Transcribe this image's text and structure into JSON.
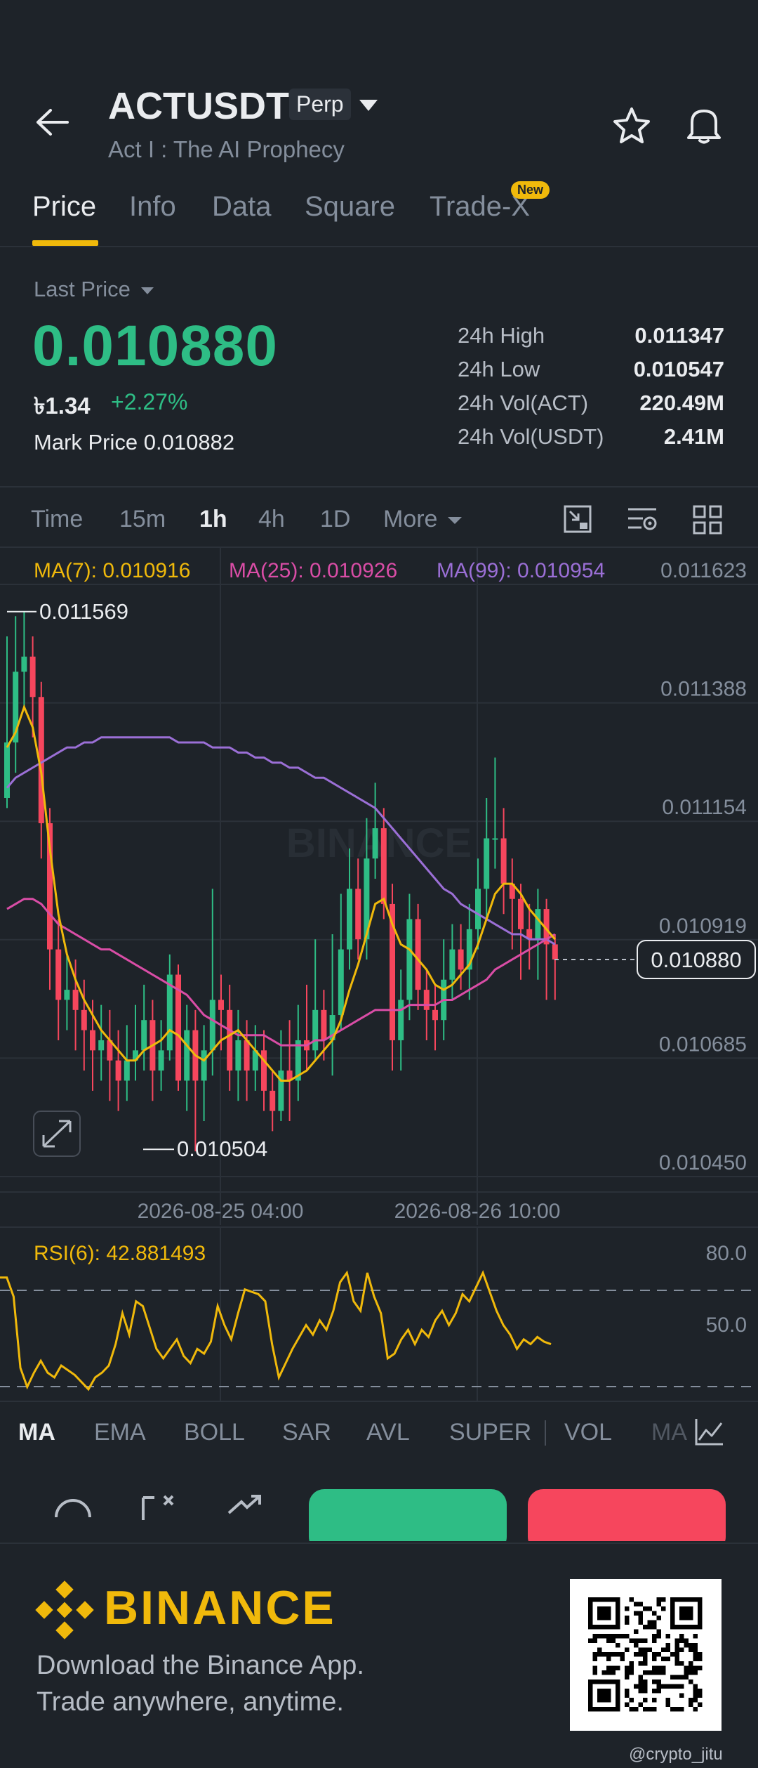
{
  "header": {
    "symbol": "ACTUSDT",
    "contract_badge": "Perp",
    "subtitle": "Act I : The AI Prophecy"
  },
  "tabs": [
    {
      "label": "Price",
      "active": true
    },
    {
      "label": "Info"
    },
    {
      "label": "Data"
    },
    {
      "label": "Square"
    },
    {
      "label": "Trade-X",
      "badge": "New"
    }
  ],
  "price": {
    "selector_label": "Last Price",
    "last_price": "0.010880",
    "fiat_value": "৳1.34",
    "change_pct": "+2.27%",
    "mark_label": "Mark Price",
    "mark_value": "0.010882",
    "stats": [
      {
        "label": "24h High",
        "value": "0.011347"
      },
      {
        "label": "24h Low",
        "value": "0.010547"
      },
      {
        "label": "24h Vol(ACT)",
        "value": "220.49M"
      },
      {
        "label": "24h Vol(USDT)",
        "value": "2.41M"
      }
    ]
  },
  "intervals": [
    {
      "label": "Time"
    },
    {
      "label": "15m"
    },
    {
      "label": "1h",
      "active": true
    },
    {
      "label": "4h"
    },
    {
      "label": "1D"
    },
    {
      "label": "More"
    }
  ],
  "ma_legend": {
    "ma7": "MA(7): 0.010916",
    "ma25": "MA(25): 0.010926",
    "ma99": "MA(99): 0.010954"
  },
  "watermark": "BINANCE",
  "chart_data": [
    {
      "type": "candlestick",
      "y_ticks": [
        "0.011623",
        "0.011388",
        "0.011154",
        "0.010919",
        "0.010685",
        "0.010450"
      ],
      "ylim": [
        0.01045,
        0.011623
      ],
      "x_ticks": [
        "2026-08-25 04:00",
        "2026-08-26 10:00"
      ],
      "high_marker": "0.011569",
      "low_marker": "0.010504",
      "current_price_label": "0.010880",
      "colors": {
        "up": "#2ebd85",
        "down": "#f6465d",
        "ma7": "#f0b90b",
        "ma25": "#d94da6",
        "ma99": "#9b6fd6"
      },
      "candles": [
        [
          0.0112,
          0.01131,
          0.01118,
          0.01152
        ],
        [
          0.01131,
          0.01145,
          0.01125,
          0.01156
        ],
        [
          0.01145,
          0.01148,
          0.01138,
          0.01157
        ],
        [
          0.01148,
          0.0114,
          0.01132,
          0.01152
        ],
        [
          0.0114,
          0.01115,
          0.01108,
          0.01143
        ],
        [
          0.01115,
          0.0109,
          0.01082,
          0.01118
        ],
        [
          0.0109,
          0.0108,
          0.01072,
          0.01096
        ],
        [
          0.0108,
          0.01082,
          0.01074,
          0.01089
        ],
        [
          0.01082,
          0.01078,
          0.0107,
          0.01088
        ],
        [
          0.01078,
          0.01074,
          0.01066,
          0.01084
        ],
        [
          0.01074,
          0.0107,
          0.01062,
          0.0108
        ],
        [
          0.0107,
          0.01072,
          0.01064,
          0.01079
        ],
        [
          0.01072,
          0.01068,
          0.0106,
          0.01078
        ],
        [
          0.01068,
          0.01064,
          0.01058,
          0.01074
        ],
        [
          0.01064,
          0.01068,
          0.0106,
          0.01075
        ],
        [
          0.01068,
          0.0107,
          0.01064,
          0.01079
        ],
        [
          0.0107,
          0.01076,
          0.01066,
          0.01083
        ],
        [
          0.01076,
          0.01066,
          0.0106,
          0.0108
        ],
        [
          0.01066,
          0.0107,
          0.01062,
          0.01076
        ],
        [
          0.0107,
          0.01085,
          0.01068,
          0.01089
        ],
        [
          0.01085,
          0.01064,
          0.01062,
          0.01087
        ],
        [
          0.01064,
          0.01074,
          0.01058,
          0.01079
        ],
        [
          0.01074,
          0.01064,
          0.0105,
          0.01078
        ],
        [
          0.01064,
          0.0107,
          0.01056,
          0.01075
        ],
        [
          0.0107,
          0.0108,
          0.01065,
          0.01102
        ],
        [
          0.0108,
          0.01078,
          0.0107,
          0.01085
        ],
        [
          0.01078,
          0.01066,
          0.01062,
          0.01083
        ],
        [
          0.01066,
          0.01072,
          0.0106,
          0.01078
        ],
        [
          0.01072,
          0.01066,
          0.0106,
          0.01076
        ],
        [
          0.01066,
          0.0107,
          0.01062,
          0.01075
        ],
        [
          0.0107,
          0.01062,
          0.01058,
          0.01074
        ],
        [
          0.01062,
          0.01058,
          0.01054,
          0.01066
        ],
        [
          0.01058,
          0.01066,
          0.01056,
          0.01074
        ],
        [
          0.01066,
          0.01064,
          0.01056,
          0.01076
        ],
        [
          0.01064,
          0.01072,
          0.0106,
          0.01079
        ],
        [
          0.01072,
          0.0107,
          0.01066,
          0.01083
        ],
        [
          0.0107,
          0.01078,
          0.01068,
          0.01092
        ],
        [
          0.01078,
          0.01072,
          0.01068,
          0.01082
        ],
        [
          0.01072,
          0.01077,
          0.01065,
          0.01093
        ],
        [
          0.01077,
          0.0109,
          0.01074,
          0.01101
        ],
        [
          0.0109,
          0.01102,
          0.01086,
          0.0111
        ],
        [
          0.01102,
          0.01092,
          0.01088,
          0.01108
        ],
        [
          0.01092,
          0.01108,
          0.01088,
          0.01116
        ],
        [
          0.01108,
          0.01114,
          0.01104,
          0.01123
        ],
        [
          0.01114,
          0.01099,
          0.01096,
          0.01118
        ],
        [
          0.01099,
          0.01072,
          0.01066,
          0.01103
        ],
        [
          0.01072,
          0.0108,
          0.01066,
          0.01086
        ],
        [
          0.0108,
          0.01096,
          0.01076,
          0.01101
        ],
        [
          0.01096,
          0.01082,
          0.01078,
          0.01099
        ],
        [
          0.01082,
          0.01078,
          0.01072,
          0.01086
        ],
        [
          0.01078,
          0.01076,
          0.0107,
          0.01083
        ],
        [
          0.01076,
          0.01084,
          0.01072,
          0.01092
        ],
        [
          0.01084,
          0.0109,
          0.0108,
          0.01095
        ],
        [
          0.0109,
          0.01086,
          0.01082,
          0.01095
        ],
        [
          0.01086,
          0.01094,
          0.0108,
          0.01099
        ],
        [
          0.01094,
          0.01102,
          0.0109,
          0.01108
        ],
        [
          0.01102,
          0.01112,
          0.01096,
          0.0112
        ],
        [
          0.01112,
          0.01112,
          0.01106,
          0.01128
        ],
        [
          0.01112,
          0.01103,
          0.01097,
          0.01118
        ],
        [
          0.01103,
          0.011,
          0.0109,
          0.01108
        ],
        [
          0.011,
          0.01094,
          0.01084,
          0.01103
        ],
        [
          0.01094,
          0.01092,
          0.01086,
          0.01099
        ],
        [
          0.01092,
          0.01098,
          0.01084,
          0.01102
        ],
        [
          0.01098,
          0.01091,
          0.0108,
          0.011
        ],
        [
          0.01091,
          0.01088,
          0.0108,
          0.01093
        ]
      ],
      "ma7": [
        0.0113,
        0.01133,
        0.01138,
        0.01134,
        0.01125,
        0.0111,
        0.01097,
        0.01089,
        0.01084,
        0.0108,
        0.01077,
        0.01074,
        0.01072,
        0.0107,
        0.01068,
        0.01068,
        0.0107,
        0.01071,
        0.01072,
        0.01074,
        0.01073,
        0.01071,
        0.01069,
        0.01068,
        0.0107,
        0.01072,
        0.01073,
        0.01074,
        0.01072,
        0.0107,
        0.01068,
        0.01066,
        0.01064,
        0.01064,
        0.01065,
        0.01066,
        0.01068,
        0.0107,
        0.01072,
        0.01076,
        0.01082,
        0.01087,
        0.01093,
        0.01099,
        0.011,
        0.01095,
        0.01091,
        0.0109,
        0.01088,
        0.01086,
        0.01083,
        0.01082,
        0.01083,
        0.01085,
        0.01087,
        0.01091,
        0.01096,
        0.01101,
        0.01103,
        0.01103,
        0.01101,
        0.01098,
        0.01096,
        0.01094,
        0.01092
      ],
      "ma25": [
        0.01098,
        0.01099,
        0.011,
        0.011,
        0.01099,
        0.01097,
        0.01095,
        0.01094,
        0.01093,
        0.01092,
        0.01091,
        0.0109,
        0.0109,
        0.01089,
        0.01088,
        0.01087,
        0.01086,
        0.01085,
        0.01084,
        0.01083,
        0.01082,
        0.01081,
        0.01079,
        0.01077,
        0.01076,
        0.01075,
        0.01074,
        0.01073,
        0.01073,
        0.01073,
        0.01073,
        0.01072,
        0.01071,
        0.01071,
        0.01071,
        0.01071,
        0.01072,
        0.01072,
        0.01073,
        0.01074,
        0.01075,
        0.01076,
        0.01077,
        0.01078,
        0.01078,
        0.01078,
        0.01078,
        0.01079,
        0.01079,
        0.01079,
        0.01079,
        0.0108,
        0.0108,
        0.01081,
        0.01082,
        0.01083,
        0.01084,
        0.01086,
        0.01087,
        0.01088,
        0.01089,
        0.0109,
        0.01091,
        0.01092,
        0.01093
      ],
      "ma99": [
        0.01122,
        0.01124,
        0.01125,
        0.01126,
        0.01127,
        0.01128,
        0.01129,
        0.0113,
        0.0113,
        0.01131,
        0.01131,
        0.01132,
        0.01132,
        0.01132,
        0.01132,
        0.01132,
        0.01132,
        0.01132,
        0.01132,
        0.01132,
        0.01131,
        0.01131,
        0.01131,
        0.01131,
        0.0113,
        0.0113,
        0.0113,
        0.01129,
        0.01129,
        0.01128,
        0.01128,
        0.01127,
        0.01127,
        0.01126,
        0.01126,
        0.01125,
        0.01124,
        0.01124,
        0.01123,
        0.01122,
        0.01121,
        0.0112,
        0.01119,
        0.01118,
        0.01116,
        0.01114,
        0.01112,
        0.0111,
        0.01108,
        0.01106,
        0.01104,
        0.01102,
        0.01101,
        0.01099,
        0.01098,
        0.01097,
        0.01096,
        0.01095,
        0.01094,
        0.01093,
        0.01093,
        0.01092,
        0.01092,
        0.01092,
        0.01091
      ]
    },
    {
      "type": "line",
      "label": "RSI(6): 42.881493",
      "y_ticks": [
        "80.0",
        "50.0"
      ],
      "ylim": [
        20,
        85
      ],
      "values": [
        70,
        70,
        62,
        32,
        24,
        30,
        35,
        30,
        28,
        33,
        31,
        29,
        26,
        23,
        28,
        30,
        33,
        42,
        55,
        46,
        60,
        58,
        49,
        40,
        36,
        40,
        44,
        37,
        34,
        40,
        38,
        43,
        58,
        50,
        44,
        55,
        65,
        64,
        63,
        60,
        42,
        28,
        34,
        40,
        45,
        50,
        46,
        52,
        48,
        56,
        68,
        72,
        60,
        56,
        72,
        62,
        55,
        36,
        38,
        44,
        48,
        42,
        48,
        45,
        52,
        56,
        50,
        55,
        63,
        60,
        66,
        72,
        64,
        56,
        50,
        46,
        40,
        44,
        42,
        45,
        43,
        42
      ]
    }
  ],
  "indicators": [
    {
      "label": "MA",
      "active": true
    },
    {
      "label": "EMA"
    },
    {
      "label": "BOLL"
    },
    {
      "label": "SAR"
    },
    {
      "label": "AVL"
    },
    {
      "label": "SUPER"
    },
    {
      "label": "VOL"
    },
    {
      "label": "MA"
    }
  ],
  "footer": {
    "brand": "BINANCE",
    "line1": "Download the Binance App.",
    "line2": "Trade anywhere, anytime.",
    "credit": "@crypto_jitu"
  }
}
